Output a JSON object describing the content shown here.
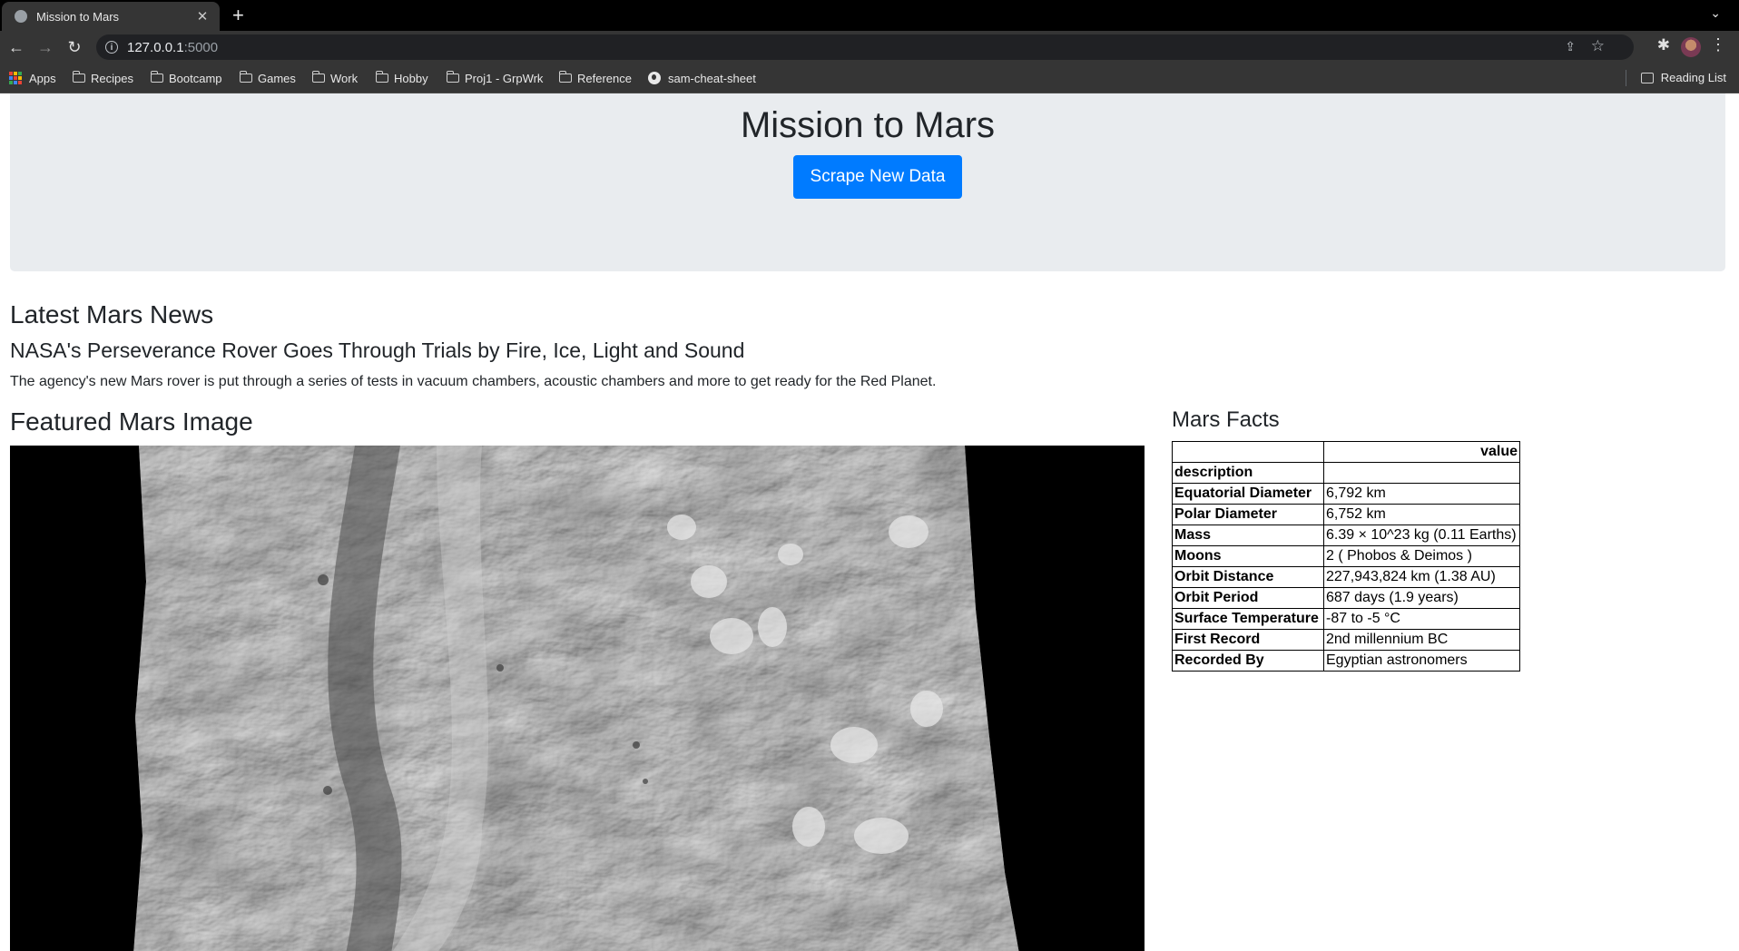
{
  "browser": {
    "tab_title": "Mission to Mars",
    "url_host": "127.0.0.1",
    "url_port": ":5000",
    "bookmarks": [
      "Apps",
      "Recipes",
      "Bootcamp",
      "Games",
      "Work",
      "Hobby",
      "Proj1 - GrpWrk",
      "Reference",
      "sam-cheat-sheet"
    ],
    "reading_list": "Reading List"
  },
  "page": {
    "title": "Mission to Mars",
    "scrape_button": "Scrape New Data",
    "news_heading": "Latest Mars News",
    "news_title": "NASA's Perseverance Rover Goes Through Trials by Fire, Ice, Light and Sound",
    "news_teaser": "The agency's new Mars rover is put through a series of tests in vacuum chambers, acoustic chambers and more to get ready for the Red Planet.",
    "image_heading": "Featured Mars Image",
    "facts_heading": "Mars Facts",
    "facts_table": {
      "header": "value",
      "index_label": "description",
      "rows": [
        {
          "key": "Equatorial Diameter",
          "value": "6,792 km"
        },
        {
          "key": "Polar Diameter",
          "value": "6,752 km"
        },
        {
          "key": "Mass",
          "value": "6.39 × 10^23 kg (0.11 Earths)"
        },
        {
          "key": "Moons",
          "value": "2 ( Phobos & Deimos )"
        },
        {
          "key": "Orbit Distance",
          "value": "227,943,824 km (1.38 AU)"
        },
        {
          "key": "Orbit Period",
          "value": "687 days (1.9 years)"
        },
        {
          "key": "Surface Temperature",
          "value": "-87 to -5 °C"
        },
        {
          "key": "First Record",
          "value": "2nd millennium BC"
        },
        {
          "key": "Recorded By",
          "value": "Egyptian astronomers"
        }
      ]
    }
  },
  "colors": {
    "primary_button": "#007bff",
    "jumbotron_bg": "#e9ecef",
    "browser_chrome": "#353535"
  }
}
